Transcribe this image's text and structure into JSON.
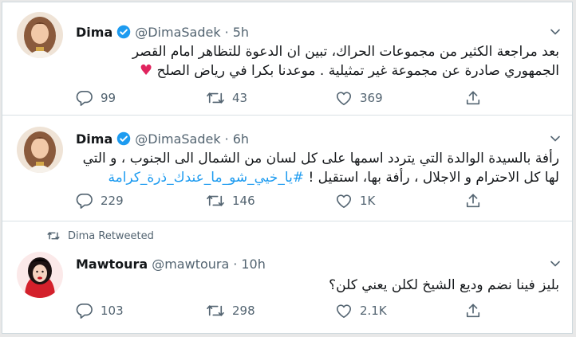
{
  "tweets": [
    {
      "name": "Dima",
      "handle": "@DimaSadek",
      "separator": "·",
      "time": "5h",
      "text_line1": "بعد مراجعة الكثير من مجموعات الحراك، تبين ان الدعوة للتظاهر امام القصر",
      "text_line2": "الجمهوري صادرة عن مجموعة غير تمثيلية . موعدنا بكرا في رياض الصلح",
      "emoji": "♥",
      "replies": "99",
      "retweets": "43",
      "likes": "369",
      "verified": true,
      "avatar_icon": "woman-portrait"
    },
    {
      "name": "Dima",
      "handle": "@DimaSadek",
      "separator": "·",
      "time": "6h",
      "text_line1": "رأفة بالسيدة الوالدة التي يتردد اسمها على كل لسان من الشمال الى الجنوب ، و التي",
      "text_line2_plain": "لها كل الاحترام و الاجلال ، رأفة بها، استقيل ! ",
      "hashtag": "#يا_خيي_شو_ما_عندك_ذرة_كرامة",
      "replies": "229",
      "retweets": "146",
      "likes": "1K",
      "verified": true,
      "avatar_icon": "woman-portrait"
    },
    {
      "retweeted_by": "Dima Retweeted",
      "name": "Mawtoura",
      "handle": "@mawtoura",
      "separator": "·",
      "time": "10h",
      "text_line1": "بليز فينا نضم وديع الشيخ لكلن يعني كلن؟",
      "replies": "103",
      "retweets": "298",
      "likes": "2.1K",
      "verified": false,
      "avatar_icon": "cartoon-woman-red"
    }
  ],
  "colors": {
    "text": "#14171a",
    "secondary": "#536471",
    "link": "#1d9bf0",
    "verified": "#1d9bf0",
    "heart": "#e0245e"
  }
}
